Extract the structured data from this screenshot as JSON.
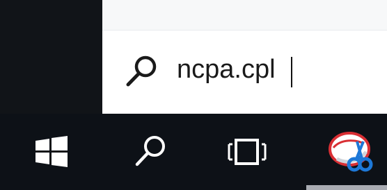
{
  "search": {
    "value": "ncpa.cpl",
    "icon": "search-icon"
  },
  "taskbar": {
    "start_icon": "windows-logo-icon",
    "search_icon": "search-icon",
    "task_view_icon": "task-view-icon",
    "pinned_app_icon": "snipping-tool-icon"
  },
  "colors": {
    "taskbar": "#0d1117",
    "search_field": "#ffffff",
    "text": "#1a1a1a",
    "accent_blue": "#1d78d8",
    "accent_red": "#d92f34"
  }
}
